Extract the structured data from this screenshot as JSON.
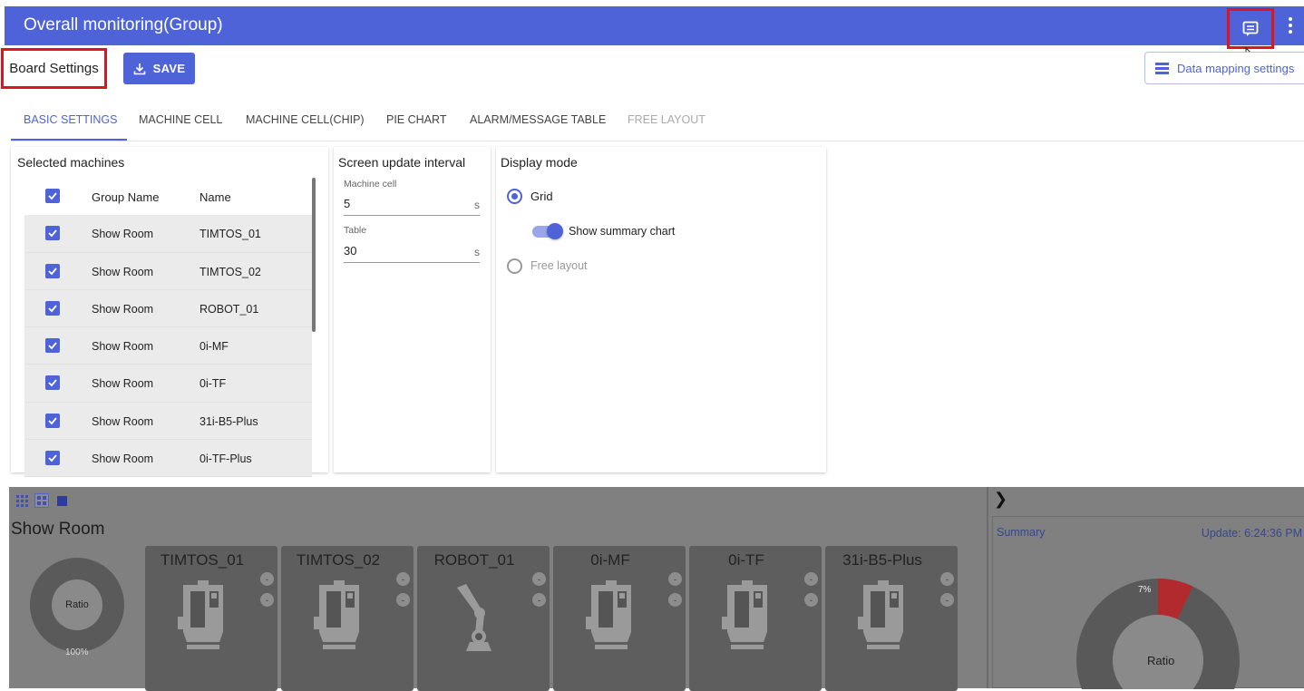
{
  "app": {
    "title": "Overall monitoring(Group)"
  },
  "toolbar": {
    "board_settings_label": "Board Settings",
    "save_label": "SAVE",
    "data_mapping_label": "Data mapping settings"
  },
  "tabs": [
    {
      "label": "BASIC SETTINGS",
      "state": "active"
    },
    {
      "label": "MACHINE CELL",
      "state": "normal"
    },
    {
      "label": "MACHINE CELL(CHIP)",
      "state": "normal"
    },
    {
      "label": "PIE CHART",
      "state": "normal"
    },
    {
      "label": "ALARM/MESSAGE TABLE",
      "state": "normal"
    },
    {
      "label": "FREE LAYOUT",
      "state": "disabled"
    }
  ],
  "selected_machines": {
    "title": "Selected machines",
    "headers": {
      "group": "Group Name",
      "name": "Name"
    },
    "rows": [
      {
        "group": "Show Room",
        "name": "TIMTOS_01",
        "checked": true
      },
      {
        "group": "Show Room",
        "name": "TIMTOS_02",
        "checked": true
      },
      {
        "group": "Show Room",
        "name": "ROBOT_01",
        "checked": true
      },
      {
        "group": "Show Room",
        "name": "0i-MF",
        "checked": true
      },
      {
        "group": "Show Room",
        "name": "0i-TF",
        "checked": true
      },
      {
        "group": "Show Room",
        "name": "31i-B5-Plus",
        "checked": true
      },
      {
        "group": "Show Room",
        "name": "0i-TF-Plus",
        "checked": true
      }
    ]
  },
  "screen_update": {
    "title": "Screen update interval",
    "machine_cell": {
      "label": "Machine cell",
      "value": "5",
      "unit": "s"
    },
    "table": {
      "label": "Table",
      "value": "30",
      "unit": "s"
    }
  },
  "display_mode": {
    "title": "Display mode",
    "grid_label": "Grid",
    "grid_selected": true,
    "summary_chart_label": "Show summary chart",
    "summary_chart_on": true,
    "free_layout_label": "Free layout",
    "free_layout_selected": false
  },
  "preview": {
    "group_title": "Show Room",
    "group_donut": {
      "center_label": "Ratio",
      "percent_label": "100%"
    },
    "machines": [
      {
        "name": "TIMTOS_01",
        "icon": "cnc-machine-icon",
        "badge1": "-",
        "badge2": "-"
      },
      {
        "name": "TIMTOS_02",
        "icon": "cnc-machine-icon",
        "badge1": "-",
        "badge2": "-"
      },
      {
        "name": "ROBOT_01",
        "icon": "robot-arm-icon",
        "badge1": "-",
        "badge2": "-"
      },
      {
        "name": "0i-MF",
        "icon": "cnc-machine-icon",
        "badge1": "-",
        "badge2": "-"
      },
      {
        "name": "0i-TF",
        "icon": "cnc-machine-icon",
        "badge1": "-",
        "badge2": "-"
      },
      {
        "name": "31i-B5-Plus",
        "icon": "cnc-machine-icon",
        "badge1": "-",
        "badge2": "-"
      }
    ],
    "summary": {
      "title": "Summary",
      "update_label": "Update: 6:24:36 PM",
      "center_label": "Ratio",
      "percent_label": "7%",
      "highlight_fraction": 0.07,
      "highlight_color": "#b2292e"
    }
  },
  "colors": {
    "primary": "#4f63d9",
    "highlight_border": "#e0141c"
  }
}
